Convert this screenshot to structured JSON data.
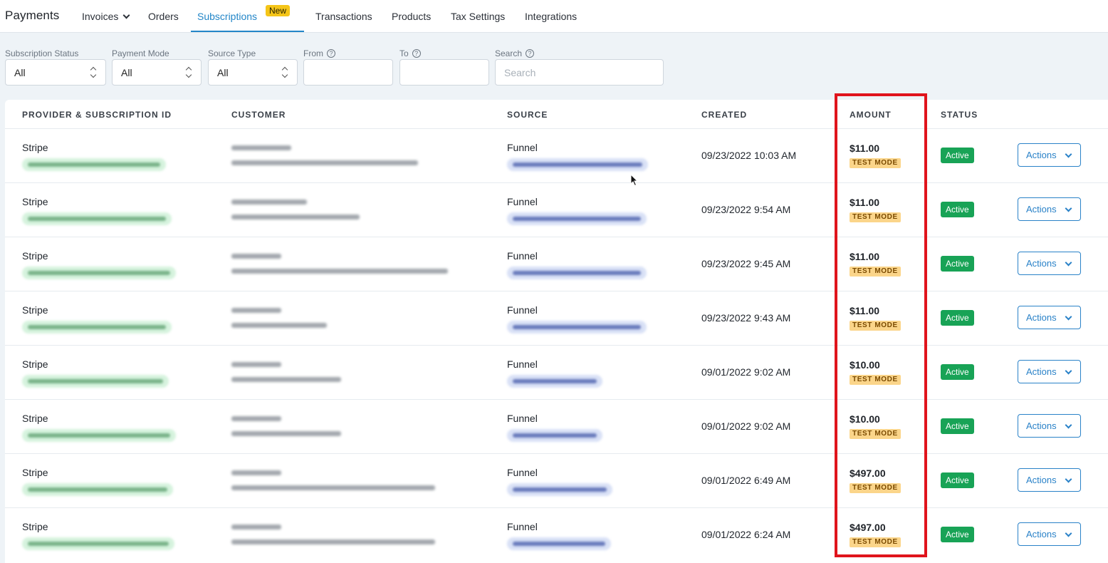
{
  "nav": {
    "brand": "Payments",
    "items": [
      "Invoices",
      "Orders",
      "Subscriptions",
      "Transactions",
      "Products",
      "Tax Settings",
      "Integrations"
    ],
    "active": "Subscriptions",
    "new_badge": "New"
  },
  "filters": {
    "subscription_status": {
      "label": "Subscription Status",
      "value": "All"
    },
    "payment_mode": {
      "label": "Payment Mode",
      "value": "All"
    },
    "source_type": {
      "label": "Source Type",
      "value": "All"
    },
    "from": {
      "label": "From",
      "value": ""
    },
    "to": {
      "label": "To",
      "value": ""
    },
    "search": {
      "label": "Search",
      "placeholder": "Search"
    }
  },
  "table": {
    "headers": [
      "PROVIDER & SUBSCRIPTION ID",
      "CUSTOMER",
      "SOURCE",
      "CREATED",
      "AMOUNT",
      "STATUS"
    ],
    "rows": [
      {
        "provider": "Stripe",
        "source": "Funnel",
        "created": "09/23/2022 10:03 AM",
        "amount": "$11.00",
        "mode": "TEST MODE",
        "status": "Active",
        "action": "Actions"
      },
      {
        "provider": "Stripe",
        "source": "Funnel",
        "created": "09/23/2022 9:54 AM",
        "amount": "$11.00",
        "mode": "TEST MODE",
        "status": "Active",
        "action": "Actions"
      },
      {
        "provider": "Stripe",
        "source": "Funnel",
        "created": "09/23/2022 9:45 AM",
        "amount": "$11.00",
        "mode": "TEST MODE",
        "status": "Active",
        "action": "Actions"
      },
      {
        "provider": "Stripe",
        "source": "Funnel",
        "created": "09/23/2022 9:43 AM",
        "amount": "$11.00",
        "mode": "TEST MODE",
        "status": "Active",
        "action": "Actions"
      },
      {
        "provider": "Stripe",
        "source": "Funnel",
        "created": "09/01/2022 9:02 AM",
        "amount": "$10.00",
        "mode": "TEST MODE",
        "status": "Active",
        "action": "Actions"
      },
      {
        "provider": "Stripe",
        "source": "Funnel",
        "created": "09/01/2022 9:02 AM",
        "amount": "$10.00",
        "mode": "TEST MODE",
        "status": "Active",
        "action": "Actions"
      },
      {
        "provider": "Stripe",
        "source": "Funnel",
        "created": "09/01/2022 6:49 AM",
        "amount": "$497.00",
        "mode": "TEST MODE",
        "status": "Active",
        "action": "Actions"
      },
      {
        "provider": "Stripe",
        "source": "Funnel",
        "created": "09/01/2022 6:24 AM",
        "amount": "$497.00",
        "mode": "TEST MODE",
        "status": "Active",
        "action": "Actions"
      }
    ]
  },
  "icons": {
    "help": "help-circle-icon",
    "select": "select-updown-icon",
    "dropdown": "chevron-down-icon",
    "cursor": "mouse-pointer-icon"
  },
  "colors": {
    "accent": "#2386c8",
    "active_green": "#18a356",
    "test_mode_bg": "#fbd58a",
    "highlight_red": "#e0141c",
    "new_badge": "#f5c518"
  }
}
